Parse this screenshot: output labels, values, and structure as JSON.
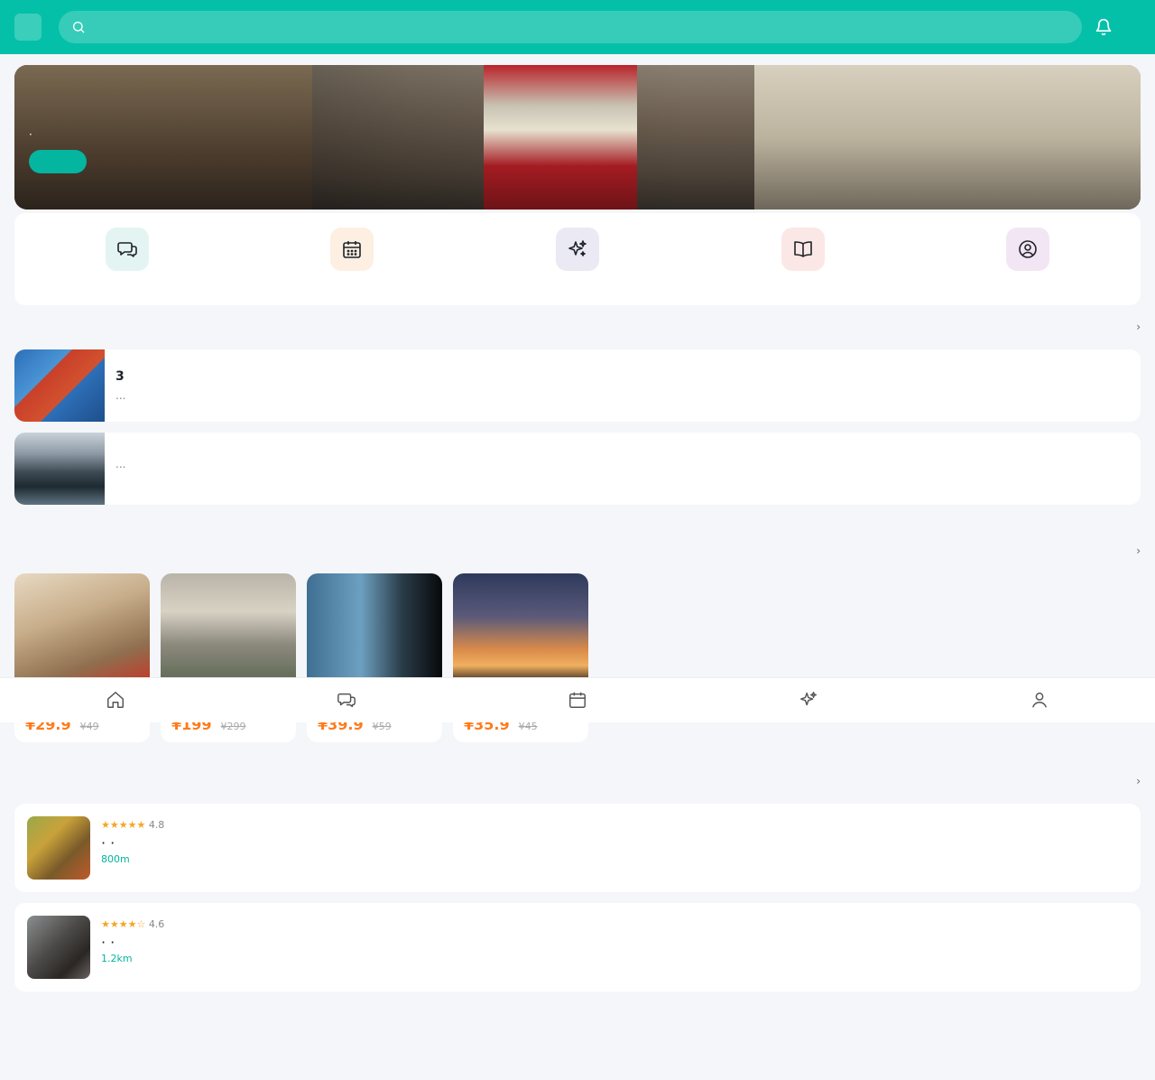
{
  "header": {
    "logo_glyph": "",
    "title": "",
    "search_placeholder": "",
    "bell_icon": "bell-icon"
  },
  "banner": {
    "title": "",
    "subtitle": " · ",
    "button": ""
  },
  "quick_entries": [
    {
      "label": "",
      "icon": "chat-icon",
      "bg": "#e4f4f2",
      "color": "#1f2329"
    },
    {
      "label": "",
      "icon": "calendar-icon",
      "bg": "#fdf0e2",
      "color": "#1f2329"
    },
    {
      "label": "",
      "icon": "sparkles-icon",
      "bg": "#eae9f4",
      "color": "#1f2329"
    },
    {
      "label": "",
      "icon": "book-icon",
      "bg": "#fbe8e6",
      "color": "#1f2329"
    },
    {
      "label": "",
      "icon": "user-circle-icon",
      "bg": "#f3e6f4",
      "color": "#1f2329"
    }
  ],
  "sections": {
    "articles": {
      "title": "",
      "more": " ›"
    },
    "products": {
      "title": "",
      "more": " ›"
    },
    "shops": {
      "title": "",
      "more": " ›"
    }
  },
  "articles": [
    {
      "title": "3",
      "desc": "..."
    },
    {
      "title": "",
      "desc": "..."
    }
  ],
  "products": [
    {
      "price": "¥29.9",
      "original": "¥49"
    },
    {
      "price": "¥199",
      "original": "¥299"
    },
    {
      "price": "¥39.9",
      "original": "¥59"
    },
    {
      "price": "¥35.9",
      "original": "¥45"
    }
  ],
  "shops": [
    {
      "name": "",
      "stars": "★★★★★",
      "rating": "4.8",
      "tags": " ·  · ",
      "distance": " 800m"
    },
    {
      "name": "",
      "stars": "★★★★☆",
      "rating": "4.6",
      "tags": " ·  · ",
      "distance": " 1.2km"
    }
  ],
  "tabbar": [
    {
      "label": "",
      "icon": "home-icon",
      "active": true
    },
    {
      "label": "",
      "icon": "chat-icon",
      "active": false
    },
    {
      "label": "",
      "icon": "calendar-icon",
      "active": false
    },
    {
      "label": "",
      "icon": "sparkles-icon",
      "active": false
    },
    {
      "label": "",
      "icon": "user-icon",
      "active": false
    }
  ],
  "colors": {
    "brand": "#04c0a8",
    "accent": "#04b59f",
    "price": "#ff7a1a",
    "stars": "#f5a623"
  }
}
